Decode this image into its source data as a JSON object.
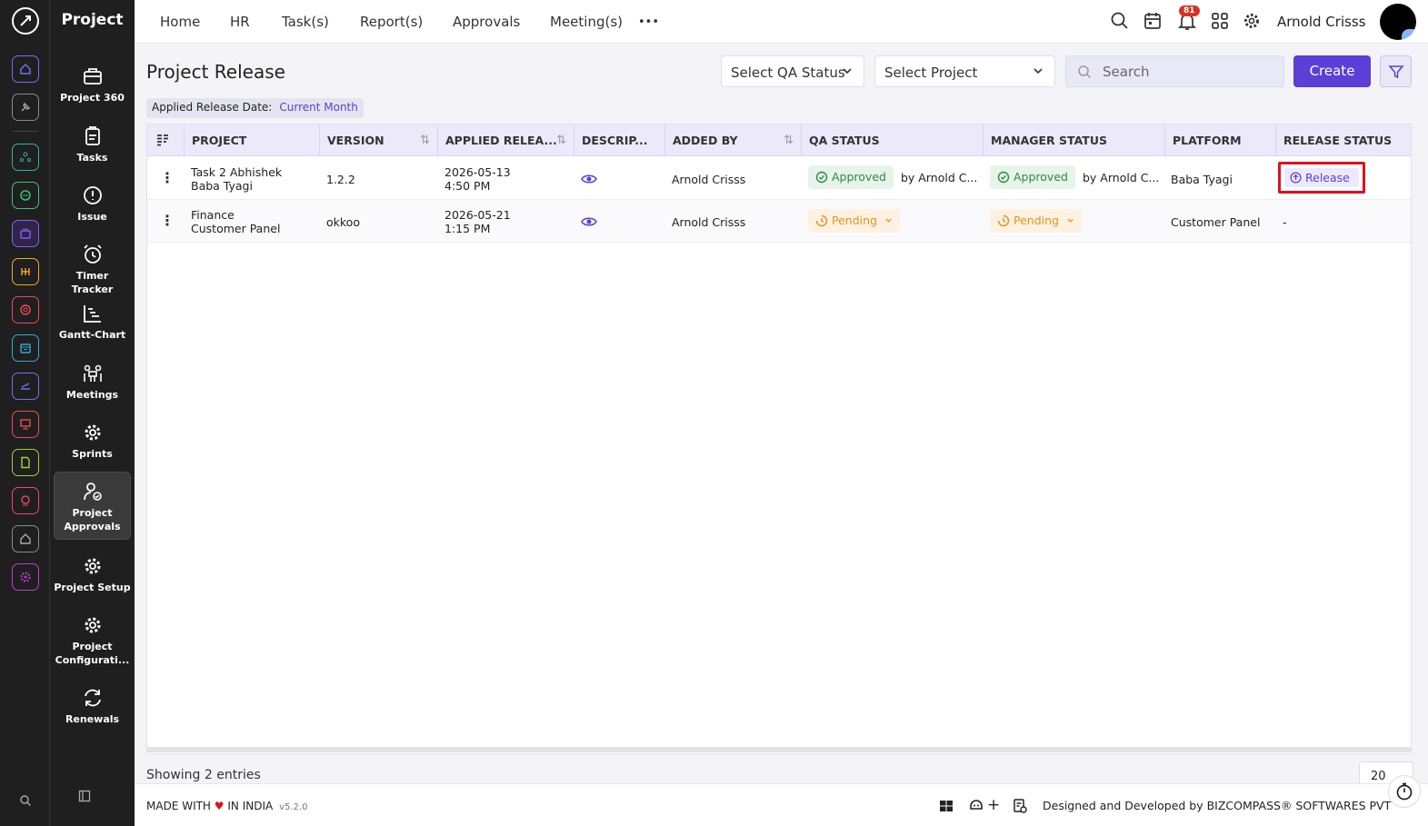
{
  "app": {
    "module_title": "Project"
  },
  "rail": {
    "modules": [
      {
        "name": "home-module",
        "color": "#7b6cf6"
      },
      {
        "name": "pin-module",
        "color": "#9a9a9a"
      },
      {
        "name": "hr-module",
        "color": "#2bb5a3"
      },
      {
        "name": "crm-module",
        "color": "#3cc46b"
      },
      {
        "name": "project-module",
        "color": "#8a5cf6"
      },
      {
        "name": "timesheet-module",
        "color": "#f5a623"
      },
      {
        "name": "target-module",
        "color": "#f0485b"
      },
      {
        "name": "archive-module",
        "color": "#2eaadc"
      },
      {
        "name": "travel-module",
        "color": "#7b6cf6"
      },
      {
        "name": "presentation-module",
        "color": "#f0485b"
      },
      {
        "name": "documents-module",
        "color": "#9ad43a"
      },
      {
        "name": "support-module",
        "color": "#f0485b"
      },
      {
        "name": "asset-module",
        "color": "#9a9a9a"
      },
      {
        "name": "settings-module",
        "color": "#c838d8"
      }
    ]
  },
  "sidebar": {
    "items": [
      {
        "label": "Project 360"
      },
      {
        "label": "Tasks"
      },
      {
        "label": "Issue"
      },
      {
        "label": "Timer Tracker"
      },
      {
        "label": "Gantt-Chart"
      },
      {
        "label": "Meetings"
      },
      {
        "label": "Sprints"
      },
      {
        "label": "Project Approvals"
      },
      {
        "label": "Project Setup"
      },
      {
        "label": "Project Configurati..."
      },
      {
        "label": "Renewals"
      }
    ]
  },
  "topnav": {
    "links": [
      "Home",
      "HR",
      "Task(s)",
      "Report(s)",
      "Approvals",
      "Meeting(s)"
    ],
    "more": "•••",
    "notification_count": "81",
    "user_name": "Arnold Crisss"
  },
  "page": {
    "title": "Project Release",
    "qa_status_placeholder": "Select QA Status",
    "project_placeholder": "Select Project",
    "search_placeholder": "Search",
    "create_label": "Create",
    "applied_filter_label": "Applied Release Date:",
    "applied_filter_value": "Current Month"
  },
  "table": {
    "columns": [
      "PROJECT",
      "VERSION",
      "APPLIED RELEA...",
      "DESCRIP...",
      "ADDED BY",
      "QA STATUS",
      "MANAGER STATUS",
      "PLATFORM",
      "RELEASE STATUS"
    ],
    "rows": [
      {
        "project": "Task 2 Abhishek",
        "subproject": "Baba Tyagi",
        "version": "1.2.2",
        "date": "2026-05-13",
        "time": "4:50 PM",
        "added_by": "Arnold Crisss",
        "qa_status": "Approved",
        "qa_by": "by Arnold C...",
        "manager_status": "Approved",
        "manager_by": "by Arnold C...",
        "platform": "Baba Tyagi",
        "release_status": "Release"
      },
      {
        "project": "Finance",
        "subproject": "Customer Panel",
        "version": "okkoo",
        "date": "2026-05-21",
        "time": "1:15 PM",
        "added_by": "Arnold Crisss",
        "qa_status": "Pending",
        "manager_status": "Pending",
        "platform": "Customer Panel",
        "release_status": "-"
      }
    ],
    "entries_text": "Showing 2 entries",
    "page_size": "20"
  },
  "footer": {
    "made_prefix": "MADE WITH",
    "made_suffix": "IN INDIA",
    "version": "v5.2.0",
    "credit": "Designed and Developed by  BIZCOMPASS® SOFTWARES PVT"
  }
}
